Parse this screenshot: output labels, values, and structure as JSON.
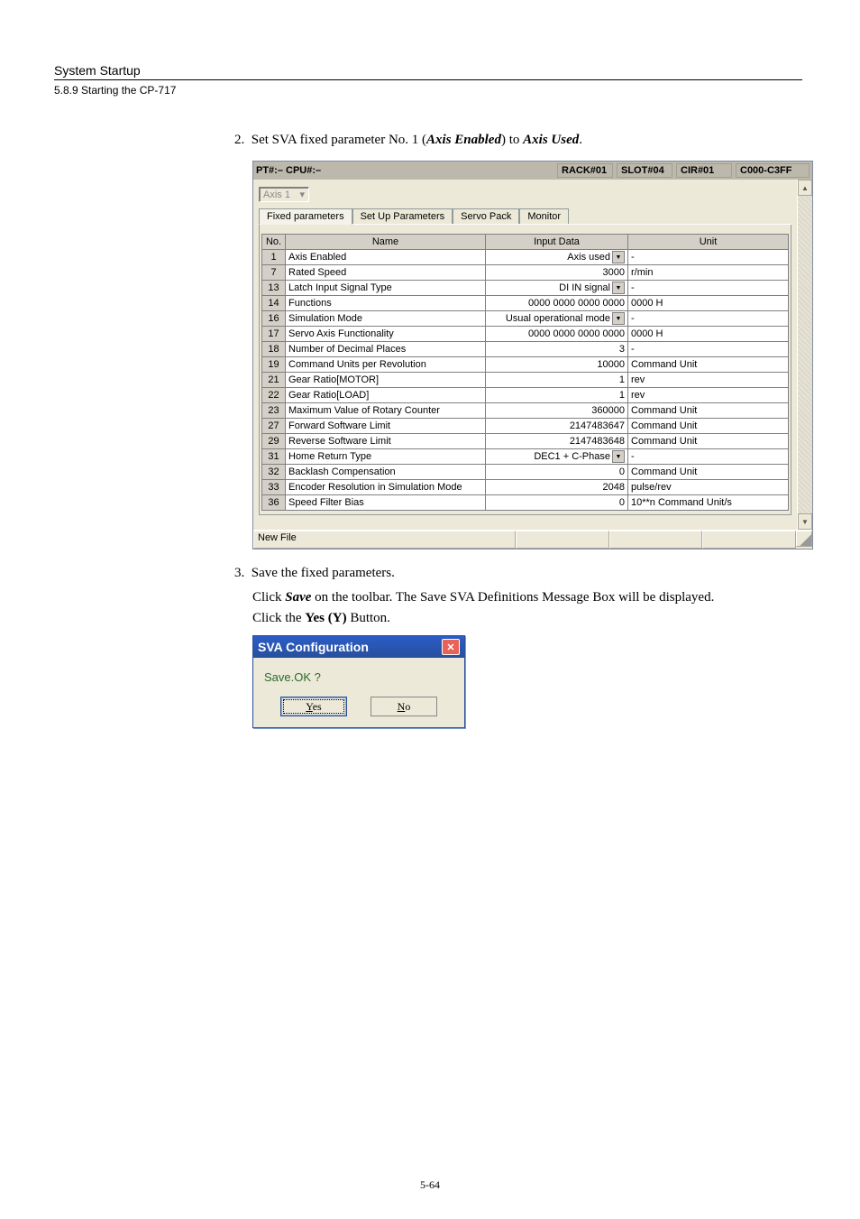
{
  "header": {
    "title": "System Startup",
    "subtitle": "5.8.9  Starting the CP-717"
  },
  "step2": {
    "num": "2.",
    "pre": "Set SVA fixed parameter No. 1 (",
    "em1": "Axis Enabled",
    "mid": ") to ",
    "em2": "Axis Used",
    "post": "."
  },
  "window": {
    "left_label": "PT#:– CPU#:–",
    "seg1": "RACK#01",
    "seg2": "SLOT#04",
    "seg3": "CIR#01",
    "seg4": "C000-C3FF",
    "axis_label": "Axis 1",
    "tabs": [
      "Fixed parameters",
      "Set Up Parameters",
      "Servo Pack",
      "Monitor"
    ],
    "col_no": "No.",
    "col_name": "Name",
    "col_data": "Input Data",
    "col_unit": "Unit",
    "rows": [
      {
        "no": "1",
        "name": "Axis Enabled",
        "data": "Axis used",
        "dd": true,
        "unit": "-"
      },
      {
        "no": "7",
        "name": "Rated Speed",
        "data": "3000",
        "unit": "r/min"
      },
      {
        "no": "13",
        "name": "Latch Input Signal Type",
        "data": "DI IN signal",
        "dd": true,
        "unit": "-"
      },
      {
        "no": "14",
        "name": "Functions",
        "data": "0000 0000 0000 0000",
        "unit": "0000 H"
      },
      {
        "no": "16",
        "name": "Simulation Mode",
        "data": "Usual operational mode",
        "dd": true,
        "unit": "-"
      },
      {
        "no": "17",
        "name": "Servo Axis Functionality",
        "data": "0000 0000 0000 0000",
        "unit": "0000 H"
      },
      {
        "no": "18",
        "name": "Number of Decimal Places",
        "data": "3",
        "unit": "-"
      },
      {
        "no": "19",
        "name": "Command Units per Revolution",
        "data": "10000",
        "unit": "Command Unit"
      },
      {
        "no": "21",
        "name": "Gear Ratio[MOTOR]",
        "data": "1",
        "unit": "rev"
      },
      {
        "no": "22",
        "name": "Gear Ratio[LOAD]",
        "data": "1",
        "unit": "rev"
      },
      {
        "no": "23",
        "name": "Maximum Value of Rotary Counter",
        "data": "360000",
        "unit": "Command Unit"
      },
      {
        "no": "27",
        "name": "Forward Software Limit",
        "data": "2147483647",
        "unit": "Command Unit"
      },
      {
        "no": "29",
        "name": "Reverse Software Limit",
        "data": "2147483648",
        "unit": "Command Unit"
      },
      {
        "no": "31",
        "name": "Home Return Type",
        "data": "DEC1 + C-Phase",
        "dd": true,
        "unit": "-"
      },
      {
        "no": "32",
        "name": "Backlash Compensation",
        "data": "0",
        "unit": "Command Unit"
      },
      {
        "no": "33",
        "name": "Encoder Resolution in Simulation Mode",
        "data": "2048",
        "unit": "pulse/rev"
      },
      {
        "no": "36",
        "name": "Speed Filter Bias",
        "data": "0",
        "unit": "10**n Command Unit/s"
      }
    ],
    "status": "New File"
  },
  "step3": {
    "num": "3.",
    "text": "Save the fixed parameters.",
    "line1a": "Click ",
    "line1b": "Save",
    "line1c": " on the toolbar. The Save SVA Definitions Message Box will be displayed.",
    "line2a": "Click the ",
    "line2b": "Yes (Y)",
    "line2c": " Button."
  },
  "dialog": {
    "title": "SVA Configuration",
    "msg": "Save.OK ?",
    "yes": "Yes",
    "no": "No",
    "yes_u": "Y",
    "no_u": "N"
  },
  "pgno": "5-64"
}
